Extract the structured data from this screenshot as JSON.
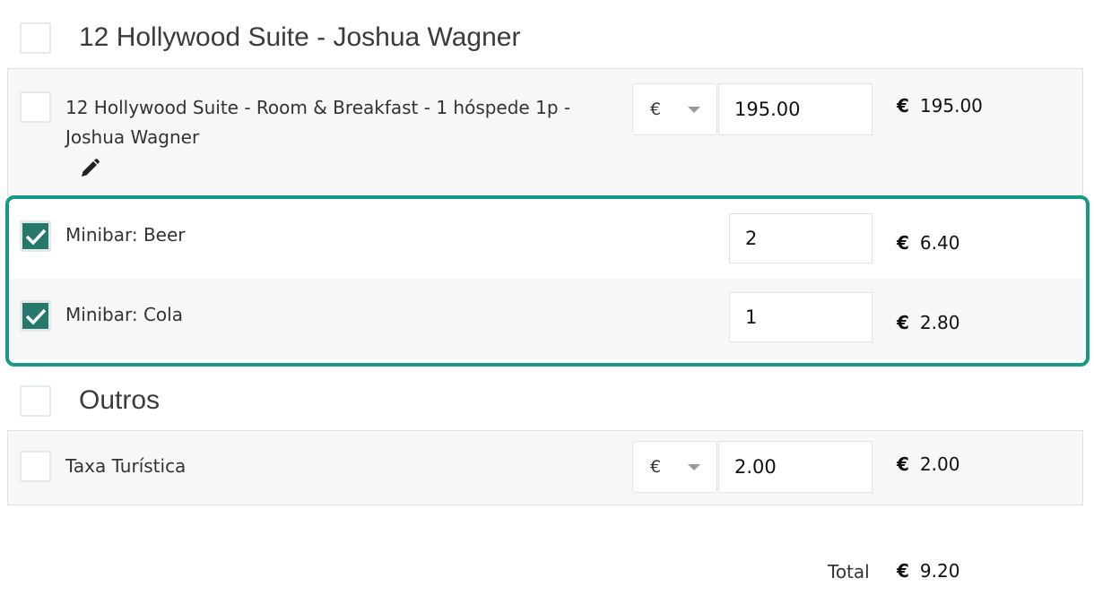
{
  "groups": [
    {
      "title": "12 Hollywood Suite - Joshua Wagner",
      "items": [
        {
          "label": "12 Hollywood Suite - Room & Breakfast - 1 hóspede 1p - Joshua Wagner",
          "currency_select": "€",
          "value": "195.00",
          "amount_currency": "€",
          "amount": "195.00",
          "checked": false
        },
        {
          "label": "Minibar: Beer",
          "value": "2",
          "amount_currency": "€",
          "amount": "6.40",
          "checked": true
        },
        {
          "label": "Minibar: Cola",
          "value": "1",
          "amount_currency": "€",
          "amount": "2.80",
          "checked": true
        }
      ]
    },
    {
      "title": "Outros",
      "items": [
        {
          "label": "Taxa Turística",
          "currency_select": "€",
          "value": "2.00",
          "amount_currency": "€",
          "amount": "2.00",
          "checked": false
        }
      ]
    }
  ],
  "total": {
    "label": "Total",
    "currency": "€",
    "value": "9.20"
  },
  "colors": {
    "accent": "#17998a",
    "checkbox_checked": "#26786c"
  }
}
